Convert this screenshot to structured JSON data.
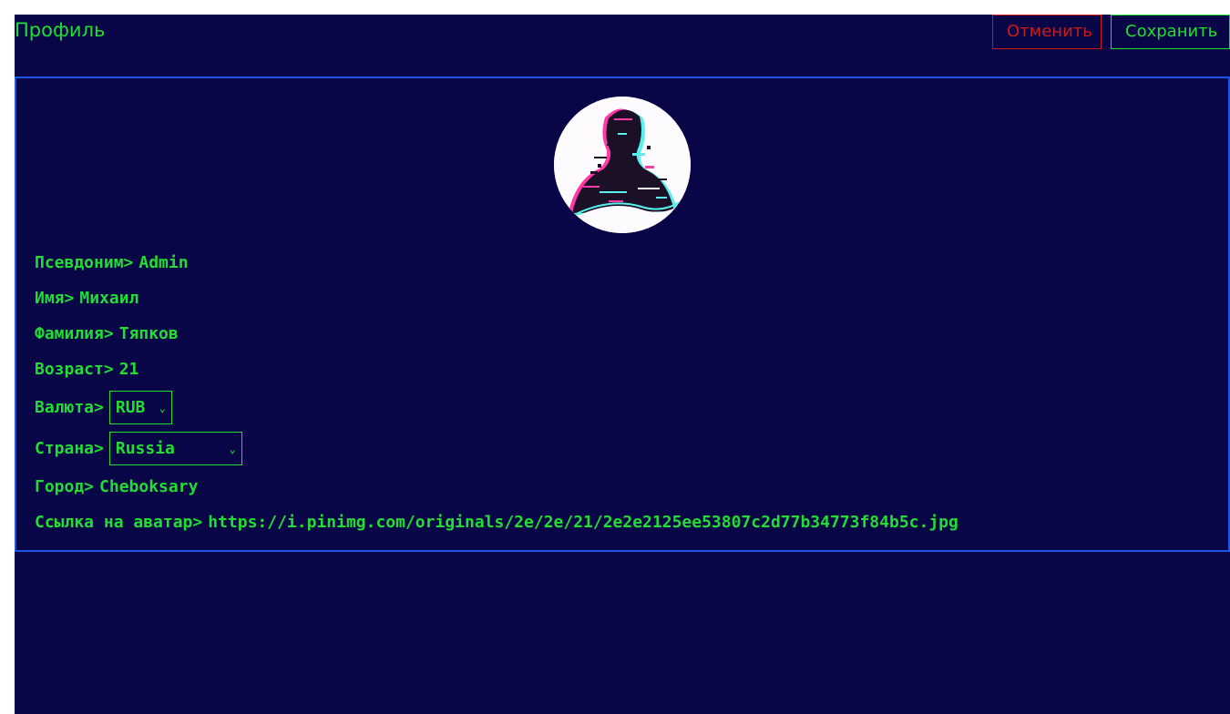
{
  "header": {
    "title": "Профиль",
    "cancel_label": "Отменить",
    "save_label": "Сохранить"
  },
  "profile": {
    "avatar_icon": "glitch-silhouette-avatar",
    "fields": [
      {
        "label": "Псевдоним>",
        "value": "Admin"
      },
      {
        "label": "Имя>",
        "value": "Михаил"
      },
      {
        "label": "Фамилия>",
        "value": "Тяпков"
      },
      {
        "label": "Возраст>",
        "value": "21"
      },
      {
        "label": "Валюта>",
        "value": "RUB"
      },
      {
        "label": "Страна>",
        "value": "Russia"
      },
      {
        "label": "Город>",
        "value": "Cheboksary"
      },
      {
        "label": "Ссылка на аватар>",
        "value": "https://i.pinimg.com/originals/2e/2e/21/2e2e2125ee53807c2d77b34773f84b5c.jpg"
      }
    ]
  },
  "colors": {
    "background": "#080646",
    "accent_green": "#22dd33",
    "cancel_red": "#cc1a1a",
    "card_border": "#1a55e6"
  }
}
